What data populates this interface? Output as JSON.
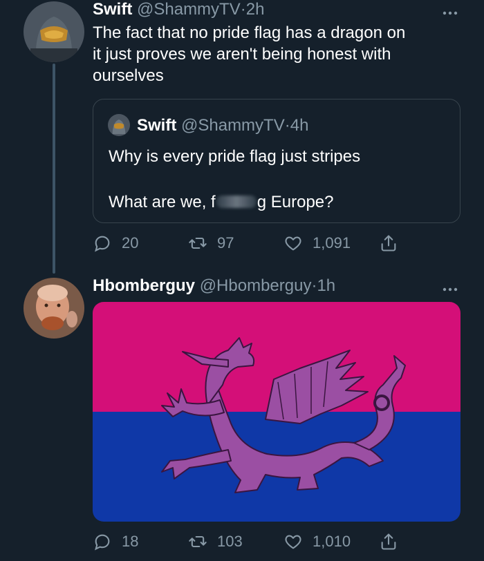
{
  "tweets": [
    {
      "name": "Swift",
      "handle": "@ShammyTV",
      "dot": "·",
      "time": "2h",
      "text_lines": [
        "The fact that no pride flag has a dragon on",
        "it just proves we aren't being honest with",
        "ourselves"
      ],
      "quote": {
        "name": "Swift",
        "handle": "@ShammyTV",
        "dot": "·",
        "time": "4h",
        "line1": "Why is every pride flag just stripes",
        "line2_start": "What are we, f",
        "line2_end": "g Europe?"
      },
      "actions": {
        "replies": "20",
        "retweets": "97",
        "likes": "1,091"
      }
    },
    {
      "name": "Hbomberguy",
      "handle": "@Hbomberguy",
      "dot": "·",
      "time": "1h",
      "image": {
        "flag_colors": {
          "top": "#d40f78",
          "bottom": "#0f38a7",
          "dragon": "#9b4fa3"
        }
      },
      "actions": {
        "replies": "18",
        "retweets": "103",
        "likes": "1,010"
      }
    }
  ],
  "colors": {
    "background": "#15202b",
    "secondary_text": "#8899a6",
    "border": "#38444d"
  },
  "icons": [
    "more-icon",
    "reply-icon",
    "retweet-icon",
    "like-icon",
    "share-icon"
  ]
}
